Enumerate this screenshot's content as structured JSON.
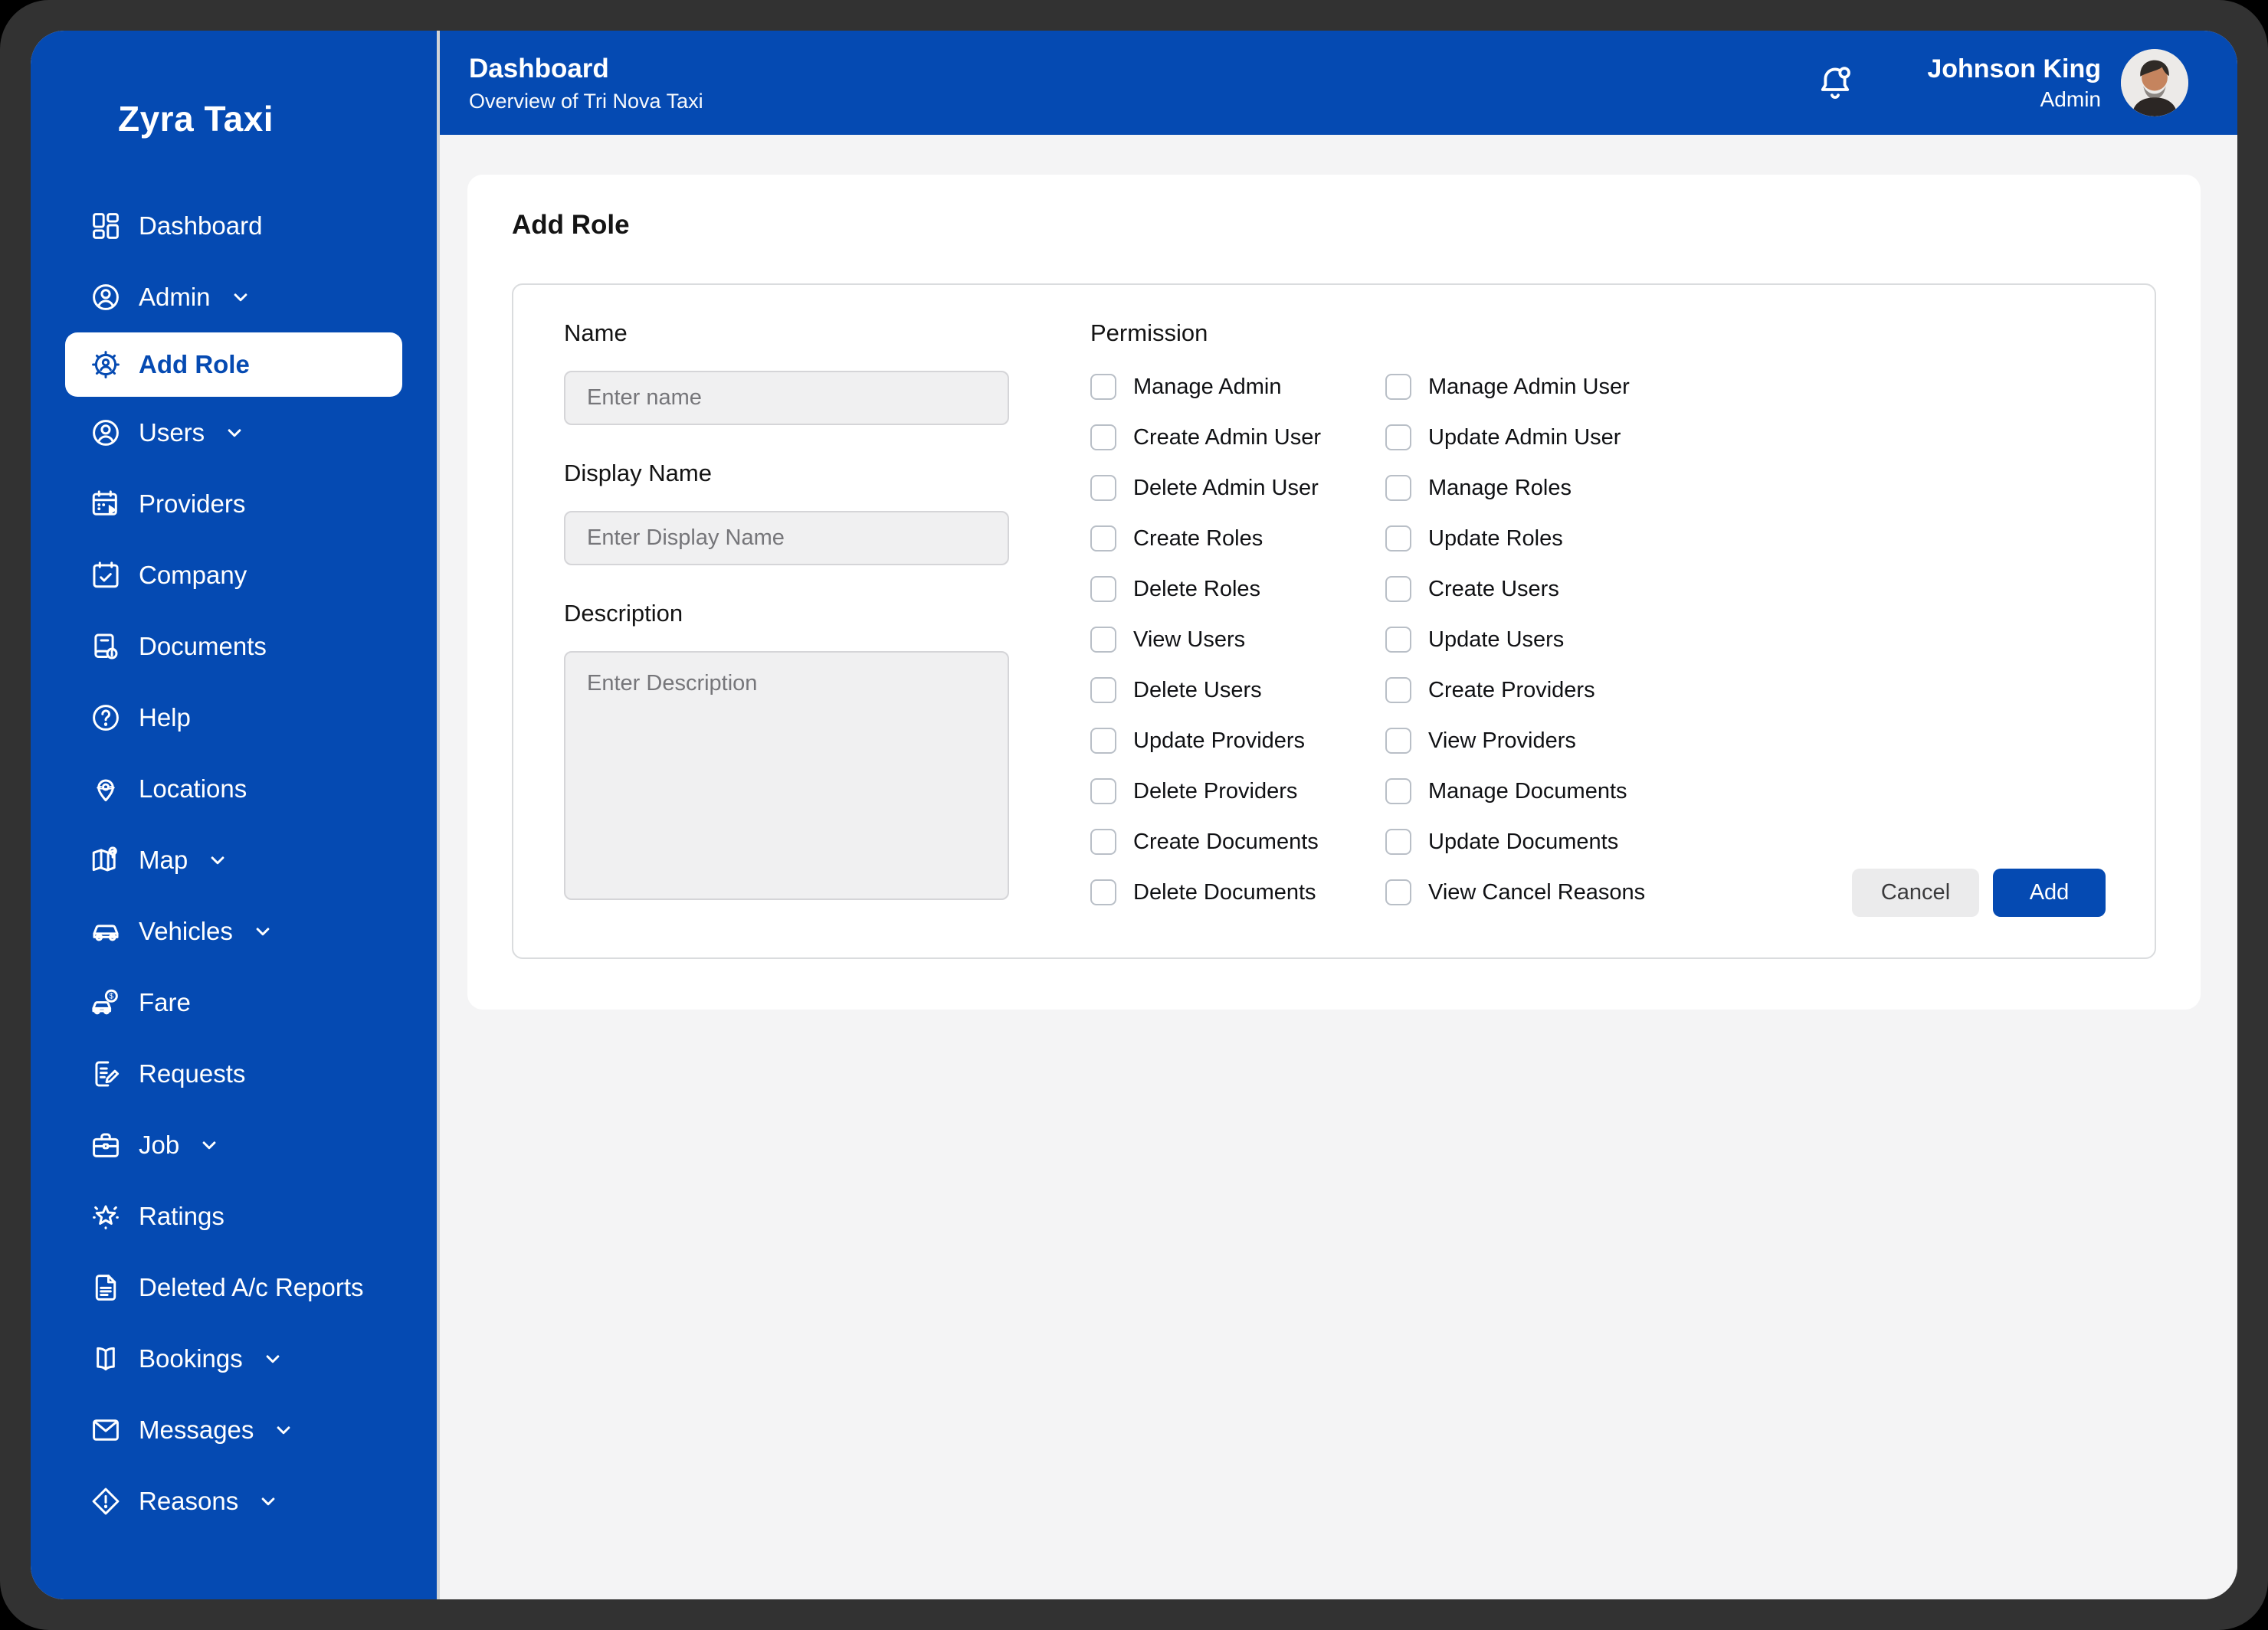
{
  "app": {
    "name": "Zyra Taxi"
  },
  "theme": {
    "primary_blue": "#054AB2",
    "frame_gray": "#323232",
    "content_gray": "#F4F4F5",
    "divider_gray": "#D2D4D7",
    "panel_border": "#DADCDE",
    "field_bg": "#F0F0F1",
    "checkbox_border": "#B9BFC7",
    "cancel_bg": "#EBEBEC"
  },
  "sidebar": {
    "logo": "Zyra Taxi",
    "items": [
      {
        "label": "Dashboard",
        "icon": "dashboard-icon",
        "expandable": false,
        "active": false
      },
      {
        "label": "Admin",
        "icon": "admin-icon",
        "expandable": true,
        "active": false
      },
      {
        "label": "Add Role",
        "icon": "add-role-icon",
        "expandable": false,
        "active": true
      },
      {
        "label": "Users",
        "icon": "users-icon",
        "expandable": true,
        "active": false
      },
      {
        "label": "Providers",
        "icon": "providers-icon",
        "expandable": false,
        "active": false
      },
      {
        "label": "Company",
        "icon": "company-icon",
        "expandable": false,
        "active": false
      },
      {
        "label": "Documents",
        "icon": "documents-icon",
        "expandable": false,
        "active": false
      },
      {
        "label": "Help",
        "icon": "help-icon",
        "expandable": false,
        "active": false
      },
      {
        "label": "Locations",
        "icon": "locations-icon",
        "expandable": false,
        "active": false
      },
      {
        "label": "Map",
        "icon": "map-icon",
        "expandable": true,
        "active": false
      },
      {
        "label": "Vehicles",
        "icon": "vehicles-icon",
        "expandable": true,
        "active": false
      },
      {
        "label": "Fare",
        "icon": "fare-icon",
        "expandable": false,
        "active": false
      },
      {
        "label": "Requests",
        "icon": "requests-icon",
        "expandable": false,
        "active": false
      },
      {
        "label": "Job",
        "icon": "job-icon",
        "expandable": true,
        "active": false
      },
      {
        "label": "Ratings",
        "icon": "ratings-icon",
        "expandable": false,
        "active": false
      },
      {
        "label": "Deleted A/c Reports",
        "icon": "deleted-reports-icon",
        "expandable": false,
        "active": false
      },
      {
        "label": "Bookings",
        "icon": "bookings-icon",
        "expandable": true,
        "active": false
      },
      {
        "label": "Messages",
        "icon": "messages-icon",
        "expandable": true,
        "active": false
      },
      {
        "label": "Reasons",
        "icon": "reasons-icon",
        "expandable": true,
        "active": false
      }
    ]
  },
  "header": {
    "title": "Dashboard",
    "subtitle": "Overview of Tri Nova Taxi",
    "bell_icon": "bell-icon",
    "user": {
      "name": "Johnson King",
      "role": "Admin",
      "avatar_icon": "avatar-photo"
    }
  },
  "form": {
    "title": "Add Role",
    "fields": {
      "name": {
        "label": "Name",
        "placeholder": "Enter name",
        "value": ""
      },
      "display_name": {
        "label": "Display Name",
        "placeholder": "Enter Display Name",
        "value": ""
      },
      "description": {
        "label": "Description",
        "placeholder": "Enter Description",
        "value": ""
      }
    },
    "permission": {
      "heading": "Permission",
      "column1": [
        "Manage Admin",
        "Create Admin User",
        "Delete Admin User",
        "Create Roles",
        "Delete Roles",
        "View Users",
        "Delete Users",
        "Update Providers",
        "Delete Providers",
        "Create Documents",
        "Delete Documents"
      ],
      "column2": [
        "Manage Admin User",
        "Update Admin User",
        "Manage Roles",
        "Update Roles",
        "Create Users",
        "Update Users",
        "Create Providers",
        "View Providers",
        "Manage Documents",
        "Update Documents",
        "View Cancel Reasons"
      ],
      "all_checked": false
    },
    "actions": {
      "cancel": "Cancel",
      "add": "Add"
    }
  }
}
